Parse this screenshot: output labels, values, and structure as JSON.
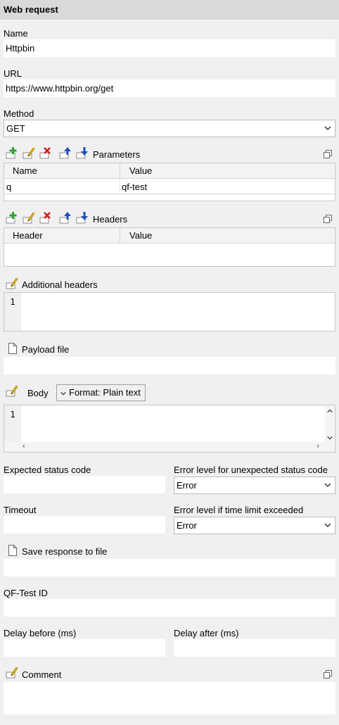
{
  "panel_title": "Web request",
  "name": {
    "label": "Name",
    "value": "Httpbin"
  },
  "url": {
    "label": "URL",
    "value": "https://www.httpbin.org/get"
  },
  "method": {
    "label": "Method",
    "value": "GET"
  },
  "parameters": {
    "label": "Parameters",
    "columns": [
      "Name",
      "Value"
    ],
    "rows": [
      {
        "name": "q",
        "value": "qf-test"
      }
    ]
  },
  "headers": {
    "label": "Headers",
    "columns": [
      "Header",
      "Value"
    ]
  },
  "additional_headers": {
    "label": "Additional headers",
    "line_number": "1"
  },
  "payload_file": {
    "label": "Payload file",
    "value": ""
  },
  "body": {
    "label": "Body",
    "format_button": "Format: Plain text",
    "line_number": "1"
  },
  "expected_status": {
    "label": "Expected status code",
    "value": ""
  },
  "error_level_status": {
    "label": "Error level for unexpected status code",
    "value": "Error"
  },
  "timeout": {
    "label": "Timeout",
    "value": ""
  },
  "error_level_time": {
    "label": "Error level if time limit exceeded",
    "value": "Error"
  },
  "save_response": {
    "label": "Save response to file",
    "value": ""
  },
  "qftest_id": {
    "label": "QF-Test ID",
    "value": ""
  },
  "delay_before": {
    "label": "Delay before (ms)",
    "value": ""
  },
  "delay_after": {
    "label": "Delay after (ms)",
    "value": ""
  },
  "comment": {
    "label": "Comment",
    "value": ""
  },
  "colors": {
    "add": "#2fa22f",
    "remove": "#c81e1e",
    "move": "#1f4fbf",
    "edit": "#e8b400"
  }
}
